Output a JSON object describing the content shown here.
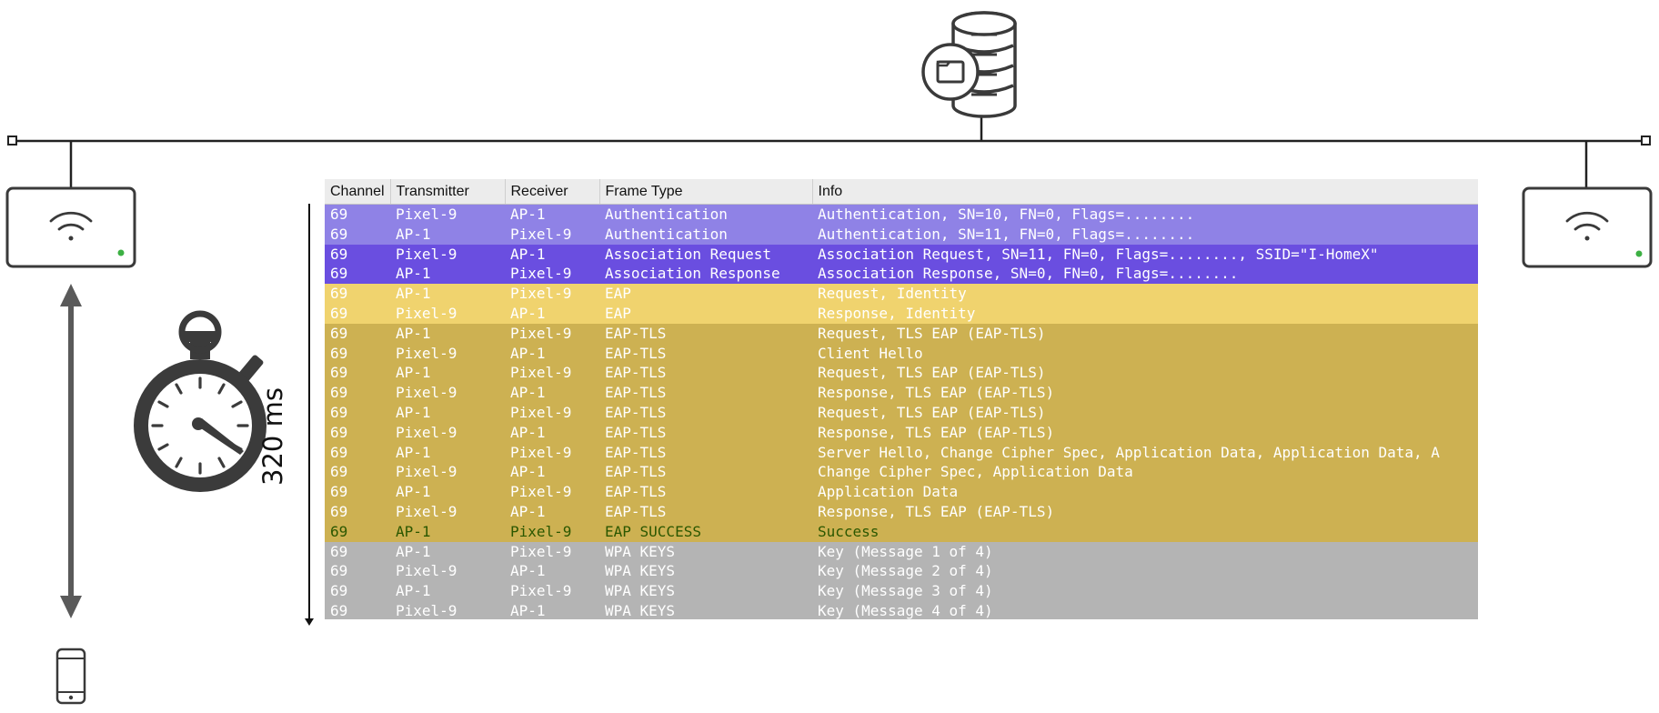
{
  "diagram": {
    "server_icon": "database-server-icon",
    "access_points": [
      {
        "icon": "wifi-access-point-icon",
        "status_color": "#3cb043"
      },
      {
        "icon": "wifi-access-point-icon",
        "status_color": "#3cb043"
      }
    ],
    "client_icon": "smartphone-icon",
    "timer_icon": "stopwatch-icon",
    "duration_label": "320 ms"
  },
  "capture": {
    "columns": [
      "Channel",
      "Transmitter",
      "Receiver",
      "Frame Type",
      "Info"
    ],
    "rows": [
      {
        "group": "auth",
        "channel": "69",
        "transmitter": "Pixel-9",
        "receiver": "AP-1",
        "frame_type": "Authentication",
        "info": "Authentication, SN=10, FN=0, Flags=........"
      },
      {
        "group": "auth",
        "channel": "69",
        "transmitter": "AP-1",
        "receiver": "Pixel-9",
        "frame_type": "Authentication",
        "info": "Authentication, SN=11, FN=0, Flags=........"
      },
      {
        "group": "assoc",
        "channel": "69",
        "transmitter": "Pixel-9",
        "receiver": "AP-1",
        "frame_type": "Association Request",
        "info": "Association Request, SN=11, FN=0, Flags=........, SSID=\"I-HomeX\""
      },
      {
        "group": "assoc",
        "channel": "69",
        "transmitter": "AP-1",
        "receiver": "Pixel-9",
        "frame_type": "Association Response",
        "info": "Association Response, SN=0, FN=0, Flags=........"
      },
      {
        "group": "eap",
        "channel": "69",
        "transmitter": "AP-1",
        "receiver": "Pixel-9",
        "frame_type": "EAP",
        "info": "Request, Identity"
      },
      {
        "group": "eap",
        "channel": "69",
        "transmitter": "Pixel-9",
        "receiver": "AP-1",
        "frame_type": "EAP",
        "info": "Response, Identity"
      },
      {
        "group": "tls",
        "channel": "69",
        "transmitter": "AP-1",
        "receiver": "Pixel-9",
        "frame_type": "EAP-TLS",
        "info": "Request, TLS EAP (EAP-TLS)"
      },
      {
        "group": "tls",
        "channel": "69",
        "transmitter": "Pixel-9",
        "receiver": "AP-1",
        "frame_type": "EAP-TLS",
        "info": "Client Hello"
      },
      {
        "group": "tls",
        "channel": "69",
        "transmitter": "AP-1",
        "receiver": "Pixel-9",
        "frame_type": "EAP-TLS",
        "info": "Request, TLS EAP (EAP-TLS)"
      },
      {
        "group": "tls",
        "channel": "69",
        "transmitter": "Pixel-9",
        "receiver": "AP-1",
        "frame_type": "EAP-TLS",
        "info": "Response, TLS EAP (EAP-TLS)"
      },
      {
        "group": "tls",
        "channel": "69",
        "transmitter": "AP-1",
        "receiver": "Pixel-9",
        "frame_type": "EAP-TLS",
        "info": "Request, TLS EAP (EAP-TLS)"
      },
      {
        "group": "tls",
        "channel": "69",
        "transmitter": "Pixel-9",
        "receiver": "AP-1",
        "frame_type": "EAP-TLS",
        "info": "Response, TLS EAP (EAP-TLS)"
      },
      {
        "group": "tls",
        "channel": "69",
        "transmitter": "AP-1",
        "receiver": "Pixel-9",
        "frame_type": "EAP-TLS",
        "info": "Server Hello, Change Cipher Spec, Application Data, Application Data, A"
      },
      {
        "group": "tls",
        "channel": "69",
        "transmitter": "Pixel-9",
        "receiver": "AP-1",
        "frame_type": "EAP-TLS",
        "info": "Change Cipher Spec, Application Data"
      },
      {
        "group": "tls",
        "channel": "69",
        "transmitter": "AP-1",
        "receiver": "Pixel-9",
        "frame_type": "EAP-TLS",
        "info": "Application Data"
      },
      {
        "group": "tls",
        "channel": "69",
        "transmitter": "Pixel-9",
        "receiver": "AP-1",
        "frame_type": "EAP-TLS",
        "info": "Response, TLS EAP (EAP-TLS)"
      },
      {
        "group": "success",
        "channel": "69",
        "transmitter": "AP-1",
        "receiver": "Pixel-9",
        "frame_type": "EAP SUCCESS",
        "info": "Success"
      },
      {
        "group": "keys",
        "channel": "69",
        "transmitter": "AP-1",
        "receiver": "Pixel-9",
        "frame_type": "WPA KEYS",
        "info": "Key (Message 1 of 4)"
      },
      {
        "group": "keys",
        "channel": "69",
        "transmitter": "Pixel-9",
        "receiver": "AP-1",
        "frame_type": "WPA KEYS",
        "info": "Key (Message 2 of 4)"
      },
      {
        "group": "keys",
        "channel": "69",
        "transmitter": "AP-1",
        "receiver": "Pixel-9",
        "frame_type": "WPA KEYS",
        "info": "Key (Message 3 of 4)"
      },
      {
        "group": "keys",
        "channel": "69",
        "transmitter": "Pixel-9",
        "receiver": "AP-1",
        "frame_type": "WPA KEYS",
        "info": "Key (Message 4 of 4)"
      }
    ],
    "row_colors": {
      "auth": "#8f82e6",
      "assoc": "#6a4ee0",
      "eap": "#f0d36e",
      "tls": "#cdb152",
      "success": "#cdb152",
      "keys": "#b4b4b4"
    },
    "success_text_color": "#2b5700"
  }
}
